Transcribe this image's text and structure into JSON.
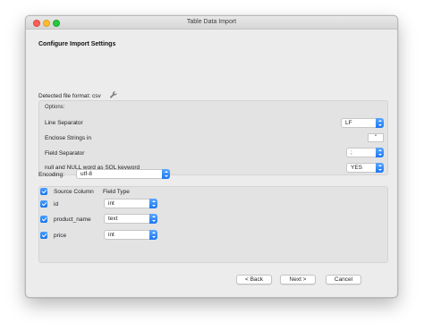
{
  "window": {
    "title": "Table Data Import"
  },
  "heading": "Configure Import Settings",
  "detected_format": "Detected file format: csv",
  "options": {
    "label": "Options:",
    "line_separator": {
      "label": "Line Separator",
      "value": "LF"
    },
    "enclose_strings": {
      "label": "Enclose Strings in",
      "value": "\""
    },
    "field_separator": {
      "label": "Field Separator",
      "value": ";"
    },
    "null_keyword": {
      "label": "null and NULL word as SQL keyword",
      "value": "YES"
    }
  },
  "encoding": {
    "label": "Encoding:",
    "value": "utf-8"
  },
  "fields": {
    "header_source": "Source Column",
    "header_type": "Field Type",
    "rows": [
      {
        "name": "id",
        "type": "int",
        "checked": true
      },
      {
        "name": "product_name",
        "type": "text",
        "checked": true
      },
      {
        "name": "price",
        "type": "int",
        "checked": true
      }
    ]
  },
  "buttons": {
    "back": "< Back",
    "next": "Next >",
    "cancel": "Cancel"
  },
  "colors": {
    "accent": "#1b78f2",
    "close": "#fe5f57",
    "minimize": "#febc2e",
    "maximize": "#28c840"
  }
}
